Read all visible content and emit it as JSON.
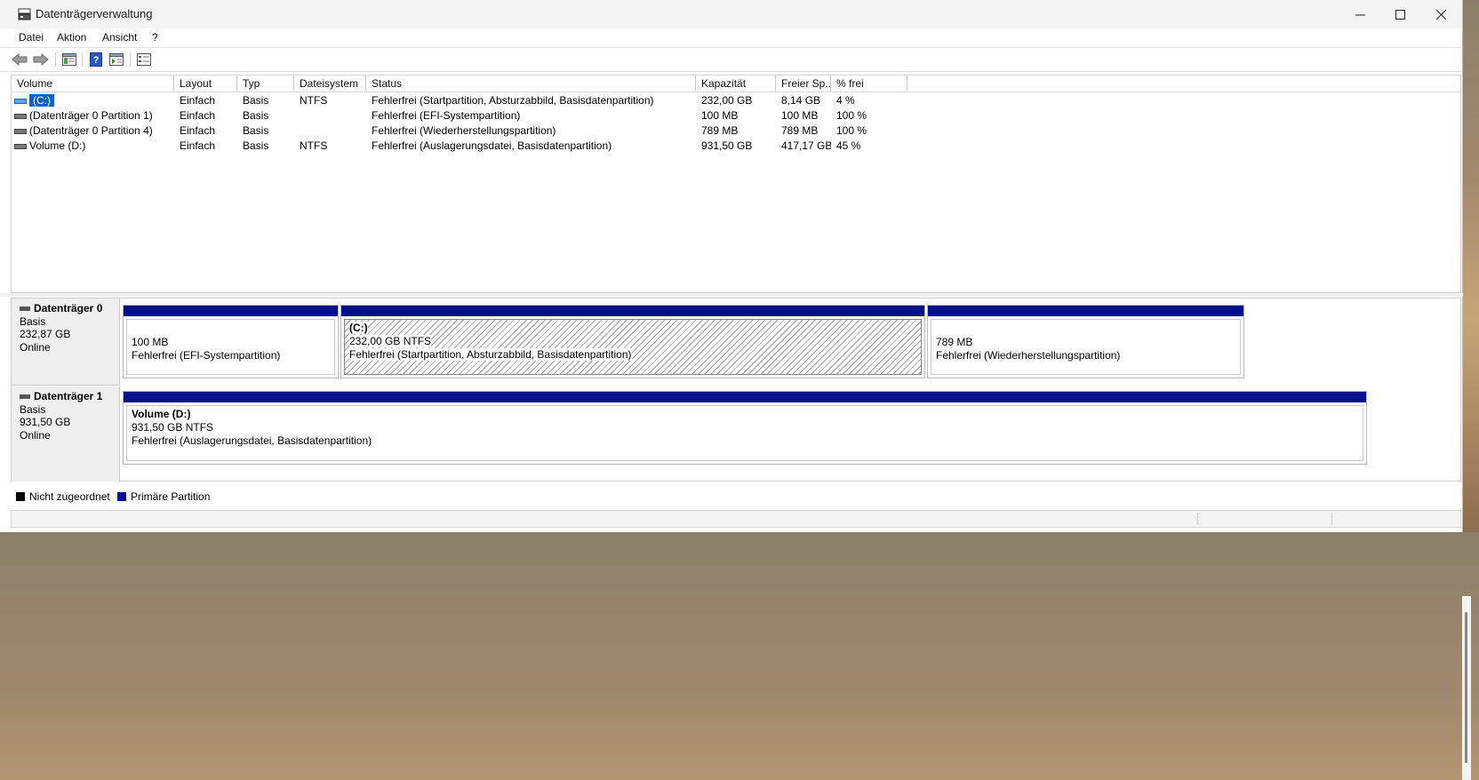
{
  "window": {
    "title": "Datenträgerverwaltung",
    "minimize": "—",
    "maximize": "☐",
    "close": "✕"
  },
  "menu": [
    "Datei",
    "Aktion",
    "Ansicht",
    "?"
  ],
  "toolbar": {
    "icons": [
      "back-arrow-icon",
      "forward-arrow-icon",
      "console-tree-icon",
      "help-icon",
      "show-details-icon",
      "properties-icon"
    ]
  },
  "volume_list": {
    "columns": [
      "Volume",
      "Layout",
      "Typ",
      "Dateisystem",
      "Status",
      "Kapazität",
      "Freier Sp...",
      "% frei"
    ],
    "rows": [
      {
        "volume": "(C:)",
        "layout": "Einfach",
        "typ": "Basis",
        "dateisystem": "NTFS",
        "status": "Fehlerfrei (Startpartition, Absturzabbild, Basisdatenpartition)",
        "kapazitaet": "232,00 GB",
        "frei": "8,14 GB",
        "prozent": "4 %"
      },
      {
        "volume": "(Datenträger 0 Partition 1)",
        "layout": "Einfach",
        "typ": "Basis",
        "dateisystem": "",
        "status": "Fehlerfrei (EFI-Systempartition)",
        "kapazitaet": "100 MB",
        "frei": "100 MB",
        "prozent": "100 %"
      },
      {
        "volume": "(Datenträger 0 Partition 4)",
        "layout": "Einfach",
        "typ": "Basis",
        "dateisystem": "",
        "status": "Fehlerfrei (Wiederherstellungspartition)",
        "kapazitaet": "789 MB",
        "frei": "789 MB",
        "prozent": "100 %"
      },
      {
        "volume": "Volume (D:)",
        "layout": "Einfach",
        "typ": "Basis",
        "dateisystem": "NTFS",
        "status": "Fehlerfrei (Auslagerungsdatei, Basisdatenpartition)",
        "kapazitaet": "931,50 GB",
        "frei": "417,17 GB",
        "prozent": "45 %"
      }
    ]
  },
  "disks": [
    {
      "name": "Datenträger 0",
      "type": "Basis",
      "size": "232,87 GB",
      "state": "Online",
      "partitions": [
        {
          "title": "",
          "size": "100 MB",
          "status": "Fehlerfrei (EFI-Systempartition)"
        },
        {
          "title": "(C:)",
          "size": "232,00 GB NTFS",
          "status": "Fehlerfrei (Startpartition, Absturzabbild, Basisdatenpartition)"
        },
        {
          "title": "",
          "size": "789 MB",
          "status": "Fehlerfrei (Wiederherstellungspartition)"
        }
      ]
    },
    {
      "name": "Datenträger 1",
      "type": "Basis",
      "size": "931,50 GB",
      "state": "Online",
      "partitions": [
        {
          "title": "Volume  (D:)",
          "size": "931,50 GB NTFS",
          "status": "Fehlerfrei (Auslagerungsdatei, Basisdatenpartition)"
        }
      ]
    }
  ],
  "legend": [
    {
      "label": "Nicht zugeordnet",
      "color": "#000000"
    },
    {
      "label": "Primäre Partition",
      "color": "#000f8c"
    }
  ],
  "colors": {
    "primary_partition": "#000f8c",
    "selection": "#0a64c8"
  }
}
